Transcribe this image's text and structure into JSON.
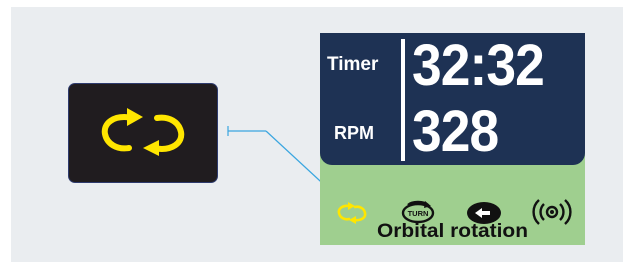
{
  "display": {
    "timer_label": "Timer",
    "timer_value": "32:32",
    "rpm_label": "RPM",
    "rpm_value": "328"
  },
  "mode_bar": {
    "active_mode_label": "Orbital rotation",
    "icons": [
      {
        "name": "orbital-rotation-icon",
        "active": true
      },
      {
        "name": "turn-icon",
        "text": "TURN",
        "active": false
      },
      {
        "name": "reciprocal-icon",
        "active": false
      },
      {
        "name": "vibration-icon",
        "active": false
      }
    ]
  },
  "callout": {
    "icon": "orbital-rotation-icon"
  },
  "colors": {
    "display_bg": "#1e3254",
    "tray_bg": "#9fcf8f",
    "active_icon": "#ffe600",
    "callout_card_bg": "#201c1f",
    "connector_line": "#3aa6e0"
  }
}
